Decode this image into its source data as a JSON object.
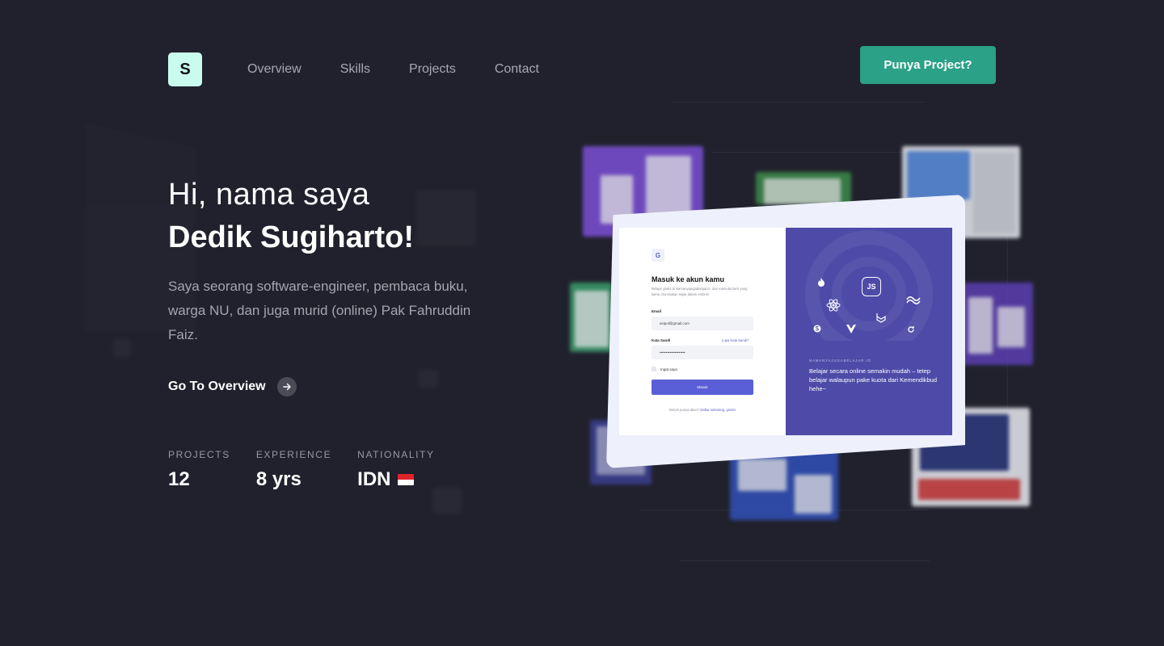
{
  "header": {
    "logo_letter": "S",
    "nav": [
      "Overview",
      "Skills",
      "Projects",
      "Contact"
    ],
    "cta_label": "Punya Project?"
  },
  "hero": {
    "greeting": "Hi, nama saya",
    "name": "Dedik Sugiharto!",
    "bio": "Saya seorang software-engineer, pembaca buku, warga NU, dan juga murid (online) Pak Fahruddin Faiz.",
    "link_label": "Go To Overview"
  },
  "stats": [
    {
      "label": "PROJECTS",
      "value": "12"
    },
    {
      "label": "EXPERIENCE",
      "value": "8 yrs"
    },
    {
      "label": "NATIONALITY",
      "value": "IDN"
    }
  ],
  "mockup": {
    "logo_letter": "G",
    "login_title": "Masuk ke akun kamu",
    "login_desc": "Belajar gratis di Namanyajugabelajar.io, dan memulai karir yang kamu cita-citakan sejak dalam embrio!",
    "email_label": "Email",
    "email_value": "asipol@gmail.com",
    "password_label": "Kata Sandi",
    "password_value": "••••••••••••••••••••",
    "forgot_label": "Lupa Kata Sandi?",
    "remember_label": "Ingat saya",
    "submit_label": "Masuk",
    "signup_text": "Belum punya akun?",
    "signup_link": "Daftar sekarang, gratis!",
    "promo_tag": "NAMANYAJUGABELAJAR.IO",
    "promo_text": "Belajar secara online semakin mudah – tetep belajar walaupun pake kuota dari Kemendikbud hehe~",
    "tech_icons": [
      "fire-icon",
      "nodejs-icon",
      "tailwind-icon",
      "react-icon",
      "laravel-icon",
      "vue-icon",
      "sass-icon",
      "refresh-icon"
    ]
  },
  "colors": {
    "background": "#21212d",
    "accent": "#2ba187",
    "logo_bg": "#c9fbee",
    "mockup_purple": "#4e4ba8"
  }
}
